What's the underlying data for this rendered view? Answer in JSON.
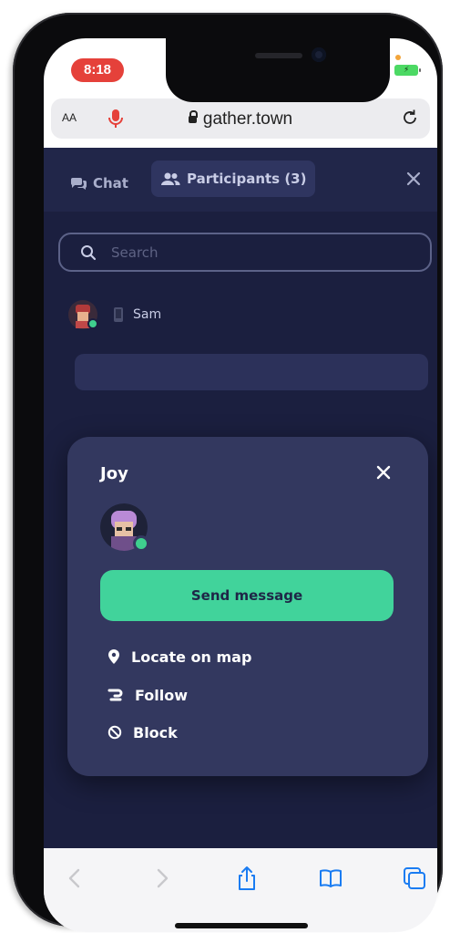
{
  "status_bar": {
    "time": "8:18",
    "signal": "....",
    "battery_glyph": "⚡"
  },
  "browser": {
    "text_size_label": "AA",
    "url": "gather.town"
  },
  "tabs": {
    "chat_label": "Chat",
    "participants_label": "Participants (3)"
  },
  "search": {
    "placeholder": "Search"
  },
  "participants": [
    {
      "name": "Sam"
    }
  ],
  "profile_popup": {
    "name": "Joy",
    "send_message_label": "Send message",
    "actions": [
      {
        "label": "Locate on map",
        "icon": "map-pin-icon"
      },
      {
        "label": "Follow",
        "icon": "follow-icon"
      },
      {
        "label": "Block",
        "icon": "block-icon"
      }
    ]
  },
  "colors": {
    "app_background": "#1b1f3f",
    "popup_background": "#33385f",
    "accent_green": "#41d39b",
    "record_red": "#e5413a"
  }
}
